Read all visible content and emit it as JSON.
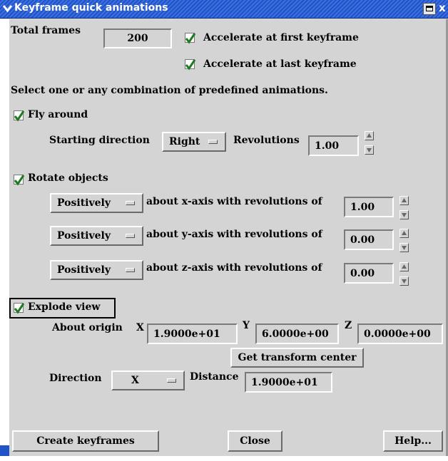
{
  "window": {
    "title": "Keyframe quick animations"
  },
  "total_frames": {
    "label": "Total frames",
    "value": "200"
  },
  "accelerate_first": {
    "label": "Accelerate at first keyframe",
    "checked": true
  },
  "accelerate_last": {
    "label": "Accelerate at last keyframe",
    "checked": true
  },
  "instructions": "Select one or any combination of predefined animations.",
  "fly_around": {
    "label": "Fly around",
    "checked": true,
    "starting_direction_label": "Starting direction",
    "starting_direction": "Right",
    "revolutions_label": "Revolutions",
    "revolutions": "1.00"
  },
  "rotate_objects": {
    "label": "Rotate objects",
    "checked": true,
    "rows": [
      {
        "sign": "Positively",
        "text": "about x-axis with revolutions of",
        "value": "1.00"
      },
      {
        "sign": "Positively",
        "text": "about y-axis with revolutions of",
        "value": "0.00"
      },
      {
        "sign": "Positively",
        "text": "about z-axis with revolutions of",
        "value": "0.00"
      }
    ]
  },
  "explode_view": {
    "label": "Explode view",
    "checked": true,
    "about_origin_label": "About origin",
    "x_label": "X",
    "x": "1.9000e+01",
    "y_label": "Y",
    "y": "6.0000e+00",
    "z_label": "Z",
    "z": "0.0000e+00",
    "get_center_label": "Get transform center",
    "direction_label": "Direction",
    "direction": "X",
    "distance_label": "Distance",
    "distance": "1.9000e+01"
  },
  "buttons": {
    "create": "Create keyframes",
    "close": "Close",
    "help": "Help..."
  },
  "colors": {
    "titlebar": "#1f53c7",
    "panel": "#d4d4d4",
    "check": "#1e7a1e"
  }
}
